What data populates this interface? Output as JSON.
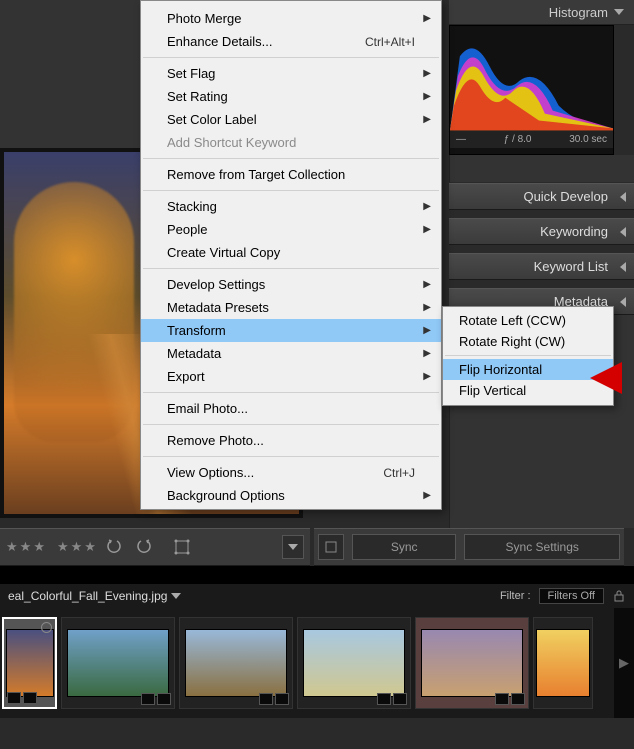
{
  "right_panel": {
    "histogram_label": "Histogram",
    "iso": "—",
    "aperture": "ƒ / 8.0",
    "shutter": "30.0 sec",
    "sections": {
      "quick_develop": "Quick Develop",
      "keywording": "Keywording",
      "keyword_list": "Keyword List",
      "metadata": "Metadata"
    }
  },
  "sync": {
    "sync_label": "Sync",
    "sync_settings_label": "Sync Settings"
  },
  "filter": {
    "filename": "eal_Colorful_Fall_Evening.jpg",
    "filter_label": "Filter :",
    "filter_value": "Filters Off"
  },
  "menu": {
    "photo_merge": "Photo Merge",
    "enhance_details": "Enhance Details...",
    "enhance_shortcut": "Ctrl+Alt+I",
    "set_flag": "Set Flag",
    "set_rating": "Set Rating",
    "set_color_label": "Set Color Label",
    "add_shortcut": "Add Shortcut Keyword",
    "remove_target": "Remove from Target Collection",
    "stacking": "Stacking",
    "people": "People",
    "create_virtual": "Create Virtual Copy",
    "develop_settings": "Develop Settings",
    "metadata_presets": "Metadata Presets",
    "transform": "Transform",
    "metadata": "Metadata",
    "export": "Export",
    "email_photo": "Email Photo...",
    "remove_photo": "Remove Photo...",
    "view_options": "View Options...",
    "view_options_shortcut": "Ctrl+J",
    "background_options": "Background Options"
  },
  "submenu": {
    "rotate_left": "Rotate Left (CCW)",
    "rotate_right": "Rotate Right (CW)",
    "flip_horizontal": "Flip Horizontal",
    "flip_vertical": "Flip Vertical"
  },
  "toolbar": {
    "star": "★"
  }
}
